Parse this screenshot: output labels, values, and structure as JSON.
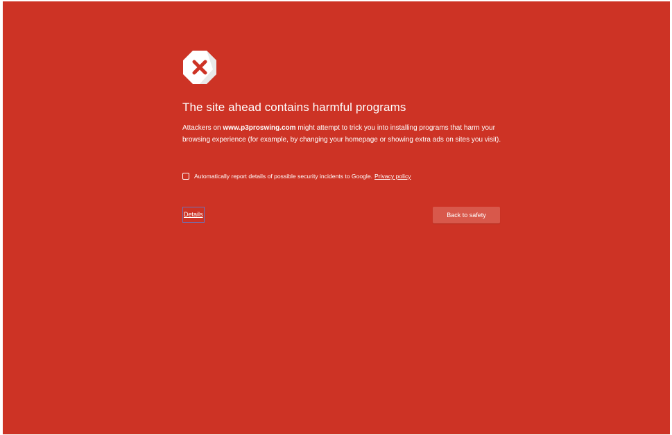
{
  "page": {
    "background_color": "#cd3325",
    "icon": "stop-sign-x-icon",
    "heading": "The site ahead contains harmful programs",
    "body": {
      "prefix": "Attackers on ",
      "site": "www.p3proswing.com",
      "suffix": " might attempt to trick you into installing programs that harm your browsing experience (for example, by changing your homepage or showing extra ads on sites you visit)."
    },
    "report": {
      "label": "Automatically report details of possible security incidents to Google.",
      "checked": false,
      "privacy_link": "Privacy policy"
    },
    "details_link": "Details",
    "back_button": "Back to safety"
  }
}
